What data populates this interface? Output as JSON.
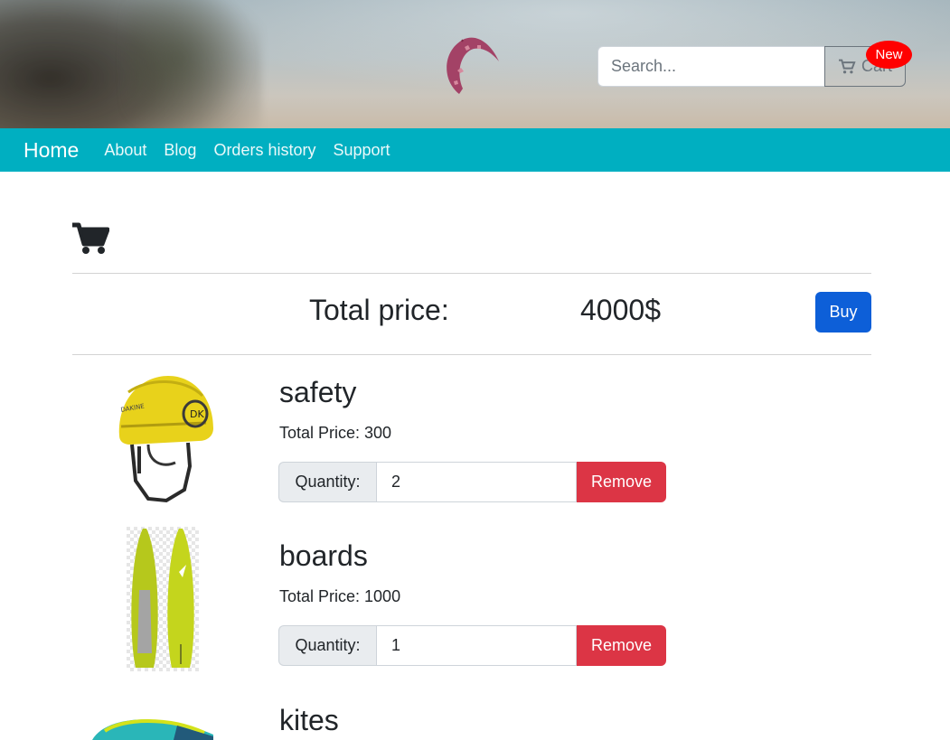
{
  "header": {
    "search": {
      "placeholder": "Search...",
      "value": ""
    },
    "cart_button": {
      "label": "Cart",
      "icon": "cart-icon",
      "badge": "New",
      "badge_color": "#ff0000"
    }
  },
  "navbar": {
    "brand": "Home",
    "links": [
      "About",
      "Blog",
      "Orders history",
      "Support"
    ],
    "color": "#00afc1"
  },
  "cart": {
    "icon": "cart-icon",
    "total_label": "Total price:",
    "total_value": "4000$",
    "buy_label": "Buy",
    "items": [
      {
        "title": "safety",
        "price_text": "Total Price: 300",
        "quantity_label": "Quantity:",
        "quantity": "2",
        "remove_label": "Remove",
        "image": "helmet-image"
      },
      {
        "title": "boards",
        "price_text": "Total Price: 1000",
        "quantity_label": "Quantity:",
        "quantity": "1",
        "remove_label": "Remove",
        "image": "board-image"
      },
      {
        "title": "kites",
        "image": "kite-image"
      }
    ]
  },
  "colors": {
    "buy": "#0d5fd8",
    "remove": "#dc3545"
  }
}
